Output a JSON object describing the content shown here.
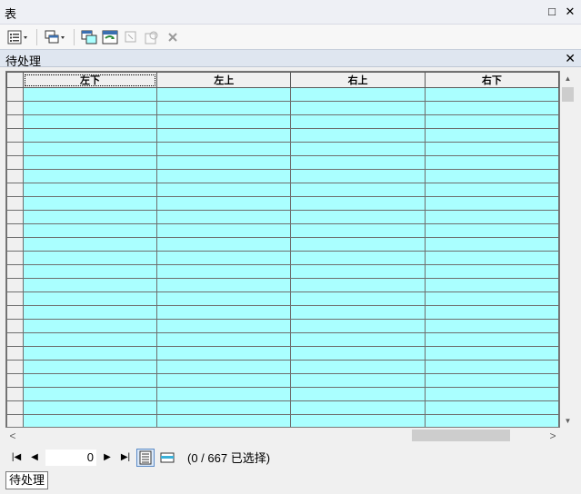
{
  "window": {
    "title": "表",
    "restore_glyph": "□",
    "close_glyph": "✕"
  },
  "toolbar": {
    "items": [
      "table-options-icon",
      "related-tables-icon",
      "select-by-attributes-icon",
      "switch-selection-icon",
      "clear-selection-icon",
      "zoom-to-selected-icon",
      "delete-selected-icon"
    ]
  },
  "tab_header": {
    "title": "待处理",
    "close_glyph": "✕"
  },
  "grid": {
    "columns": [
      "左下",
      "左上",
      "右上",
      "右下"
    ],
    "visible_row_count": 25,
    "cell_color": "#aaffff"
  },
  "navigation": {
    "current_record": "0",
    "status": "(0 / 667 已选择)",
    "first_glyph": "|◀",
    "prev_glyph": "◀",
    "next_glyph": "▶",
    "last_glyph": "▶|"
  },
  "bottom_tab": {
    "label": "待处理"
  },
  "scroll": {
    "left_glyph": "<",
    "right_glyph": ">",
    "up_glyph": "▲",
    "down_glyph": "▼"
  }
}
